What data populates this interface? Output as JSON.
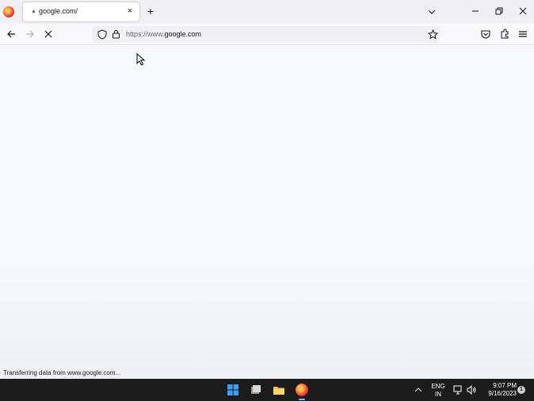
{
  "tab": {
    "title": "google.com/",
    "close_glyph": "×",
    "loading_glyph": "▲"
  },
  "toolbar": {
    "new_tab_glyph": "+"
  },
  "urlbar": {
    "prefix": "https://www.",
    "domain": "google.com"
  },
  "status_bar": {
    "text": "Transferring data from www.google.com..."
  },
  "taskbar": {
    "language_line1": "ENG",
    "language_line2": "IN",
    "time": "9:07 PM",
    "date": "9/16/2023",
    "notification_count": "1"
  },
  "icons": {
    "browser": "firefox-icon",
    "windows": "windows-start-icon",
    "files": "file-explorer-icon"
  }
}
